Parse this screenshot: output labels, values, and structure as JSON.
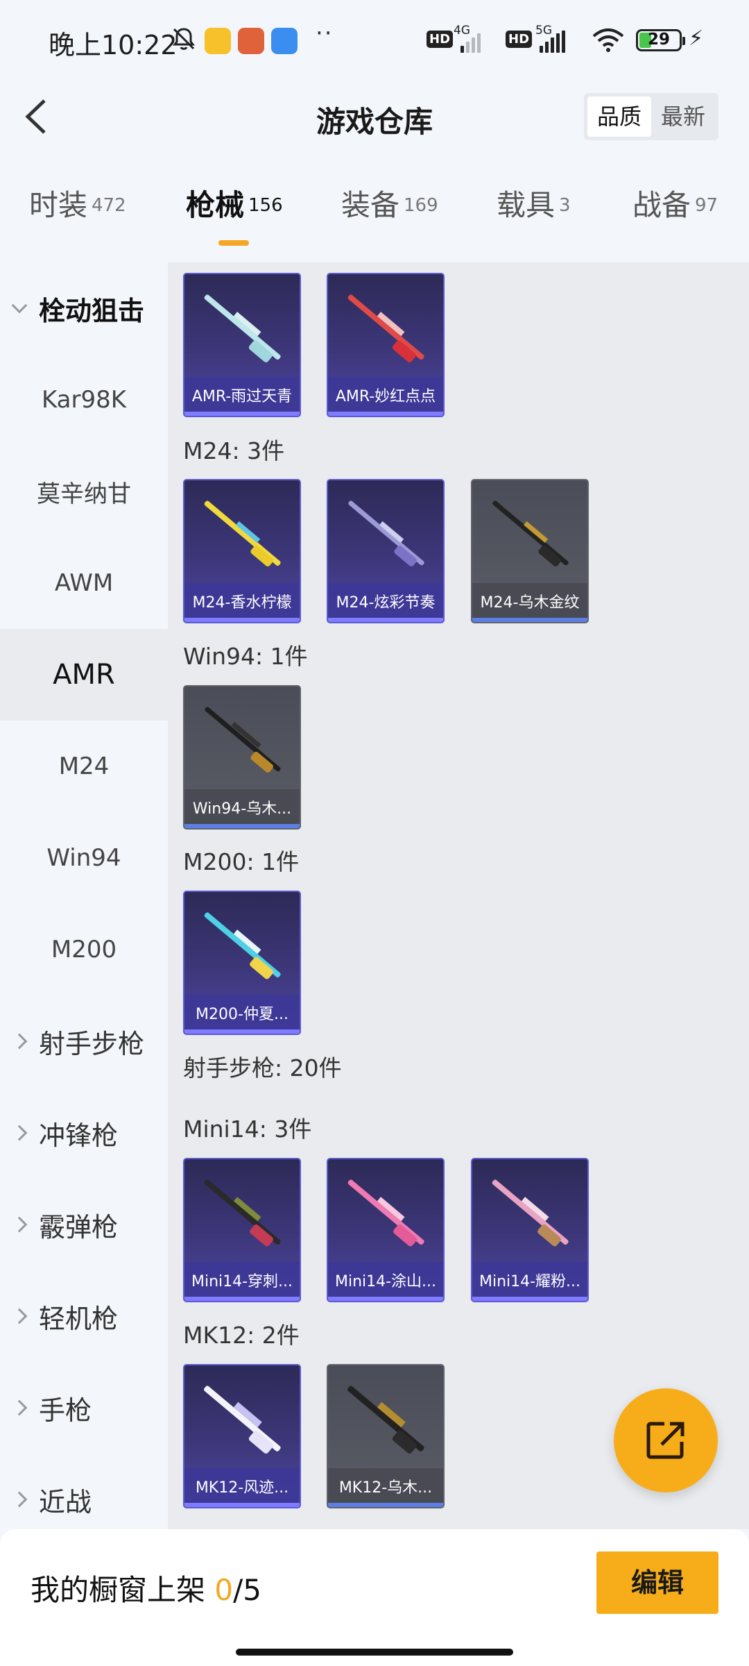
{
  "status_bar": {
    "time": "晚上10:22",
    "dots": "··",
    "hd": "HD",
    "net1": "4G",
    "net2": "5G",
    "battery": "29"
  },
  "header": {
    "title": "游戏仓库",
    "sort_quality": "品质",
    "sort_newest": "最新"
  },
  "tabs": [
    {
      "label": "时装",
      "count": "472"
    },
    {
      "label": "枪械",
      "count": "156"
    },
    {
      "label": "装备",
      "count": "169"
    },
    {
      "label": "载具",
      "count": "3"
    },
    {
      "label": "战备",
      "count": "97"
    }
  ],
  "sidebar": [
    {
      "label": "栓动狙击"
    },
    {
      "label": "Kar98K"
    },
    {
      "label": "莫辛纳甘"
    },
    {
      "label": "AWM"
    },
    {
      "label": "AMR"
    },
    {
      "label": "M24"
    },
    {
      "label": "Win94"
    },
    {
      "label": "M200"
    },
    {
      "label": "射手步枪"
    },
    {
      "label": "冲锋枪"
    },
    {
      "label": "霰弹枪"
    },
    {
      "label": "轻机枪"
    },
    {
      "label": "手枪"
    },
    {
      "label": "近战"
    }
  ],
  "sections": {
    "amr_items": [
      "AMR-雨过天青",
      "AMR-妙红点点"
    ],
    "m24_title": "M24: 3件",
    "m24_items": [
      "M24-香水柠檬",
      "M24-炫彩节奏",
      "M24-乌木金纹"
    ],
    "win94_title": "Win94: 1件",
    "win94_items": [
      "Win94-乌木..."
    ],
    "m200_title": "M200: 1件",
    "m200_items": [
      "M200-仲夏..."
    ],
    "dmr_title": "射手步枪: 20件",
    "mini14_title": "Mini14: 3件",
    "mini14_items": [
      "Mini14-穿刺...",
      "Mini14-涂山...",
      "Mini14-耀粉..."
    ],
    "mk12_title": "MK12: 2件",
    "mk12_items": [
      "MK12-风迹...",
      "MK12-乌木..."
    ]
  },
  "bottom_bar": {
    "label": "我的橱窗上架",
    "current": "0",
    "total": "/5",
    "edit": "编辑"
  },
  "colors": {
    "accent": "#f7ad1a",
    "card_purple": "#3d377a",
    "card_gray": "#5a5d66"
  }
}
